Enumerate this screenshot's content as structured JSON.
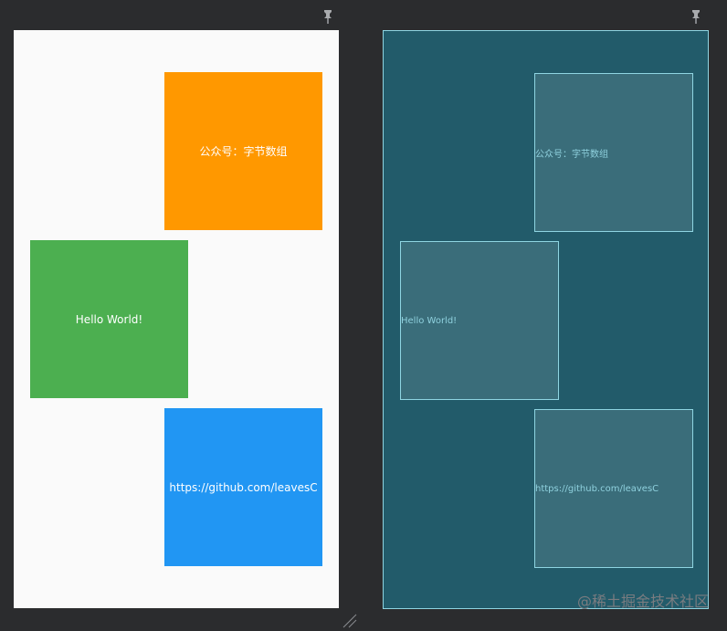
{
  "design": {
    "boxes": [
      {
        "label": "公众号：字节数组",
        "color": "#ff9800"
      },
      {
        "label": "Hello World!",
        "color": "#4caf50"
      },
      {
        "label": "https://github.com/leavesC",
        "color": "#2196f3"
      }
    ]
  },
  "blueprint": {
    "boxes": [
      {
        "label": "公众号：字节数组"
      },
      {
        "label": "Hello World!"
      },
      {
        "label": "https://github.com/leavesC"
      }
    ]
  },
  "icons": {
    "left_pin": "pin-icon",
    "right_pin": "pin-icon",
    "resize": "resize-handle-icon"
  },
  "watermark": "@稀土掘金技术社区",
  "colors": {
    "background": "#2b2c2e",
    "design_surface": "#fafafa",
    "blueprint_surface": "#225b6a",
    "blueprint_line": "#8fd5e2"
  }
}
